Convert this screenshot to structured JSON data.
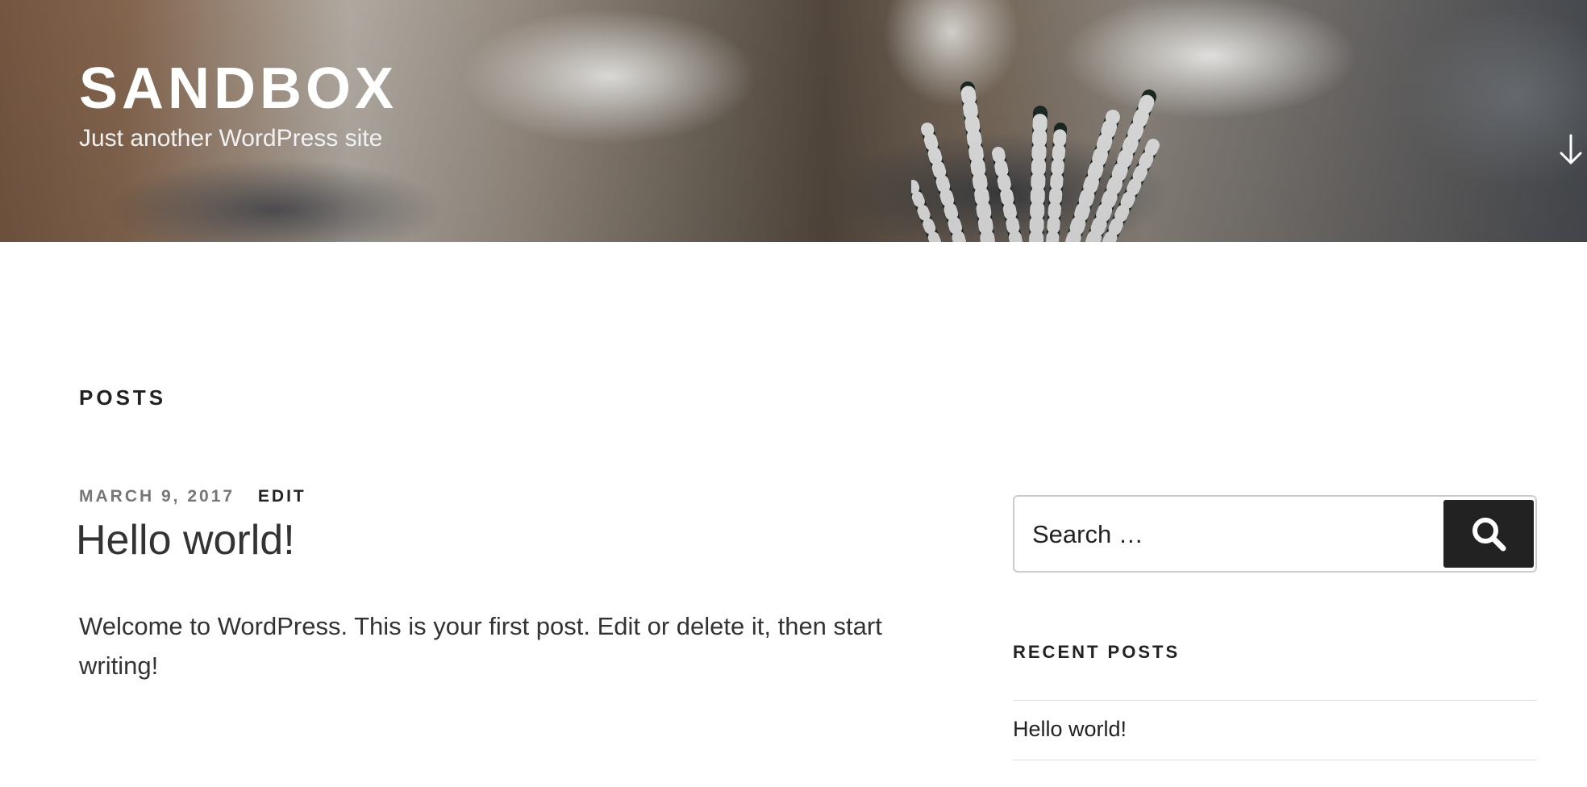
{
  "header": {
    "site_title": "SANDBOX",
    "site_description": "Just another WordPress site",
    "scroll_icon": "arrow-down-icon"
  },
  "main": {
    "page_title": "POSTS",
    "post": {
      "date": "MARCH 9, 2017",
      "edit_label": "EDIT",
      "title": "Hello world!",
      "excerpt": "Welcome to WordPress. This is your first post. Edit or delete it, then start writing!"
    }
  },
  "sidebar": {
    "search": {
      "placeholder": "Search …",
      "value": "",
      "submit_icon": "search-icon"
    },
    "recent_posts": {
      "title": "RECENT POSTS",
      "items": [
        {
          "label": "Hello world!"
        }
      ]
    }
  },
  "colors": {
    "accent": "#222222",
    "meta": "#767676",
    "border": "#dddddd"
  }
}
